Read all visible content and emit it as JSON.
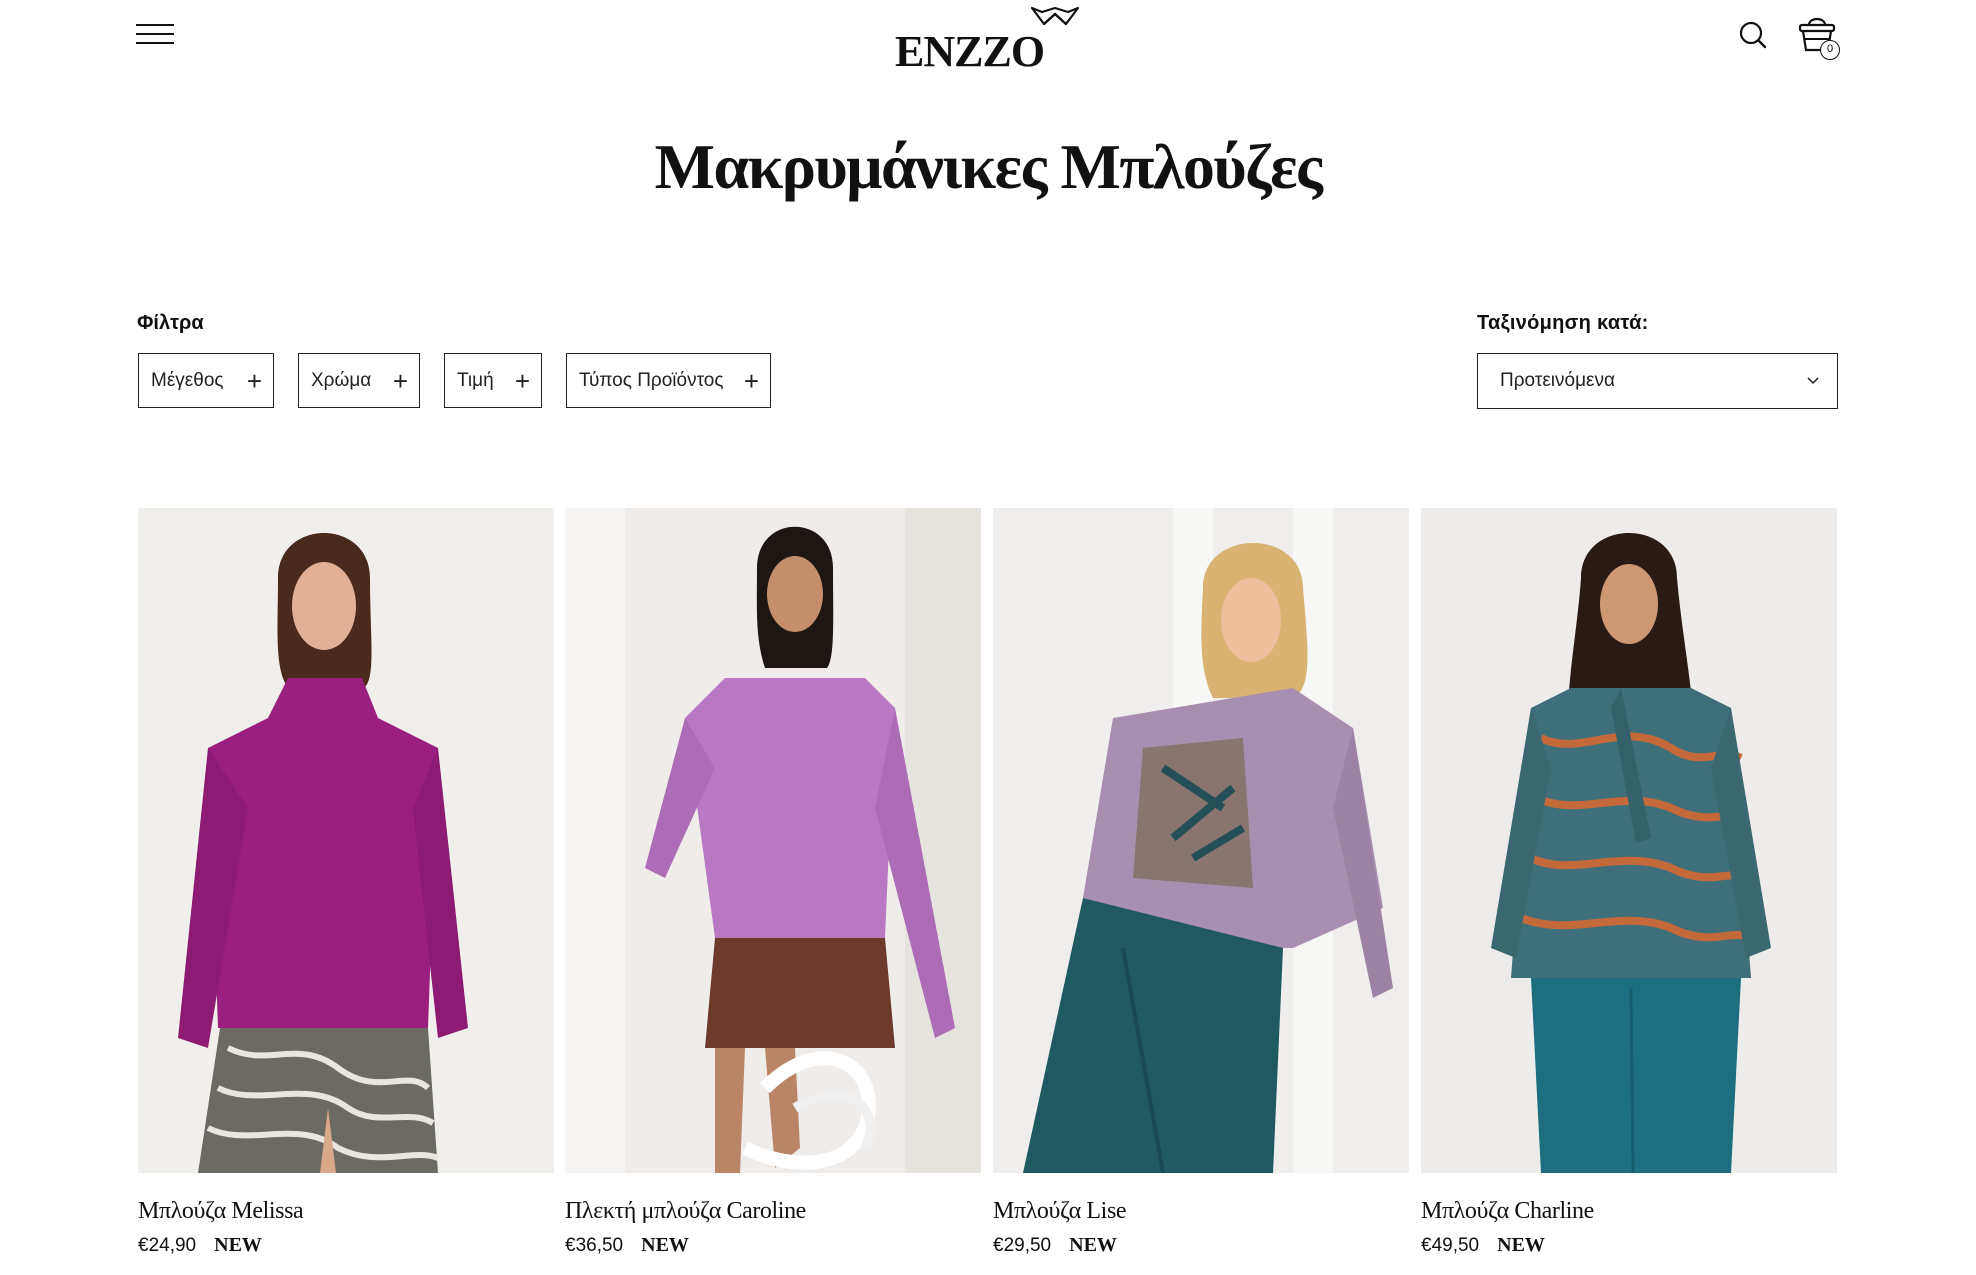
{
  "header": {
    "logo_text": "ENZZO",
    "cart_count": "0"
  },
  "page_title": "Μακρυμάνικες Μπλούζες",
  "filters": {
    "label": "Φίλτρα",
    "items": [
      {
        "label": "Μέγεθος"
      },
      {
        "label": "Χρώμα"
      },
      {
        "label": "Τιμή"
      },
      {
        "label": "Τύπος Προϊόντος"
      }
    ]
  },
  "sort": {
    "label": "Ταξινόμηση κατά:",
    "selected": "Προτεινόμενα"
  },
  "products": [
    {
      "name": "Μπλούζα Melissa",
      "price": "€24,90",
      "badge": "NEW",
      "top_color": "#9b1f7e",
      "bottom_color": "#6b6b63",
      "bg_color": "#eeebe7"
    },
    {
      "name": "Πλεκτή μπλούζα Caroline",
      "price": "€36,50",
      "badge": "NEW",
      "top_color": "#b878c2",
      "bottom_color": "#6b3a2a",
      "bg_color": "#efecea"
    },
    {
      "name": "Μπλούζα Lise",
      "price": "€29,50",
      "badge": "NEW",
      "top_color": "#a88eb0",
      "bottom_color": "#1f5a63",
      "bg_color": "#efeeec"
    },
    {
      "name": "Μπλούζα Charline",
      "price": "€49,50",
      "badge": "NEW",
      "top_color": "#3f6f7a",
      "bottom_color": "#1d6f80",
      "bg_color": "#edeceb"
    }
  ]
}
